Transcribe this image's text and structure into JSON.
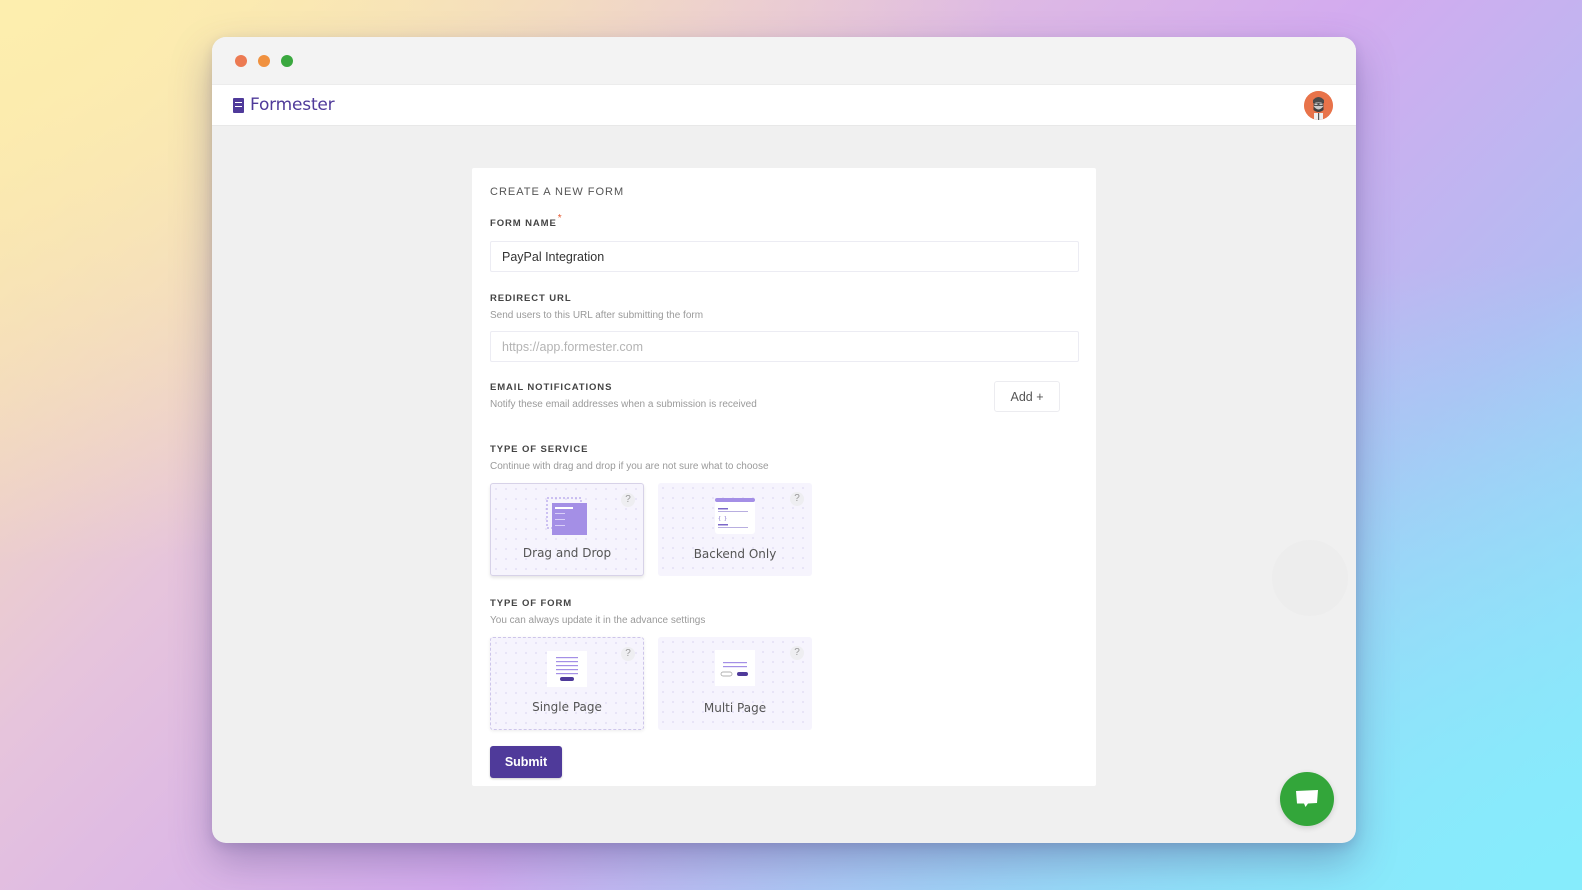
{
  "window": {
    "controls": [
      "close",
      "minimize",
      "maximize"
    ]
  },
  "app": {
    "brand": "Formester",
    "brand_color": "#4f3a9a",
    "avatar_icon": "user-avatar"
  },
  "form": {
    "title": "CREATE A NEW FORM",
    "form_name": {
      "label": "FORM NAME",
      "required_mark": "*",
      "value": "PayPal Integration",
      "placeholder": ""
    },
    "redirect_url": {
      "label": "REDIRECT URL",
      "help": "Send users to this URL after submitting the form",
      "value": "",
      "placeholder": "https://app.formester.com"
    },
    "email_notifications": {
      "label": "EMAIL NOTIFICATIONS",
      "help": "Notify these email addresses when a submission is received",
      "add_button": "Add +"
    },
    "service_type": {
      "label": "TYPE OF SERVICE",
      "help": "Continue with drag and drop if you are not sure what to choose",
      "options": [
        {
          "label": "Drag and Drop",
          "help_icon": "?",
          "selected": true
        },
        {
          "label": "Backend Only",
          "help_icon": "?",
          "selected": false
        }
      ]
    },
    "form_type": {
      "label": "TYPE OF FORM",
      "help": "You can always update it in the advance settings",
      "options": [
        {
          "label": "Single Page",
          "help_icon": "?",
          "selected": true
        },
        {
          "label": "Multi Page",
          "help_icon": "?",
          "selected": false
        }
      ]
    },
    "submit_label": "Submit"
  },
  "chat": {
    "icon": "chat-bubble-icon",
    "color": "#33a63a"
  }
}
